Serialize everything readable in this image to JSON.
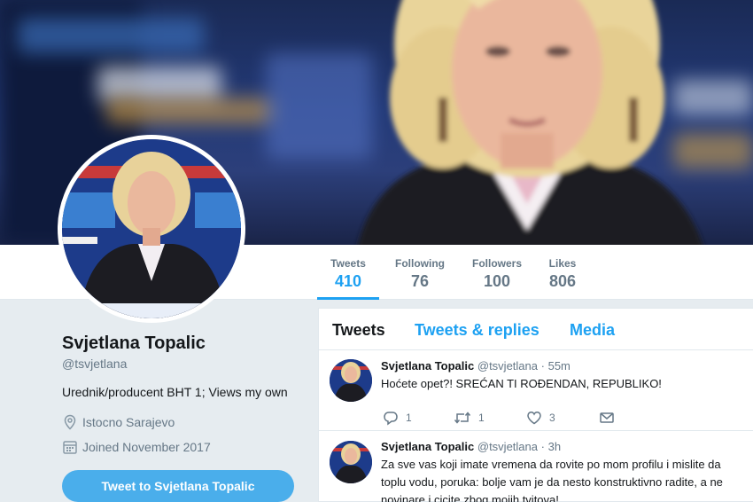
{
  "stats": [
    {
      "label": "Tweets",
      "value": "410"
    },
    {
      "label": "Following",
      "value": "76"
    },
    {
      "label": "Followers",
      "value": "100"
    },
    {
      "label": "Likes",
      "value": "806"
    }
  ],
  "profile": {
    "name": "Svjetlana Topalic",
    "handle": "@tsvjetlana",
    "bio": "Urednik/producent BHT 1; Views my own",
    "location": "Istocno Sarajevo",
    "joined": "Joined November 2017",
    "tweet_to_label": "Tweet to Svjetlana Topalic"
  },
  "tabs": [
    {
      "label": "Tweets"
    },
    {
      "label": "Tweets & replies"
    },
    {
      "label": "Media"
    }
  ],
  "tweets": [
    {
      "name": "Svjetlana Topalic",
      "handle": "@tsvjetlana",
      "dot": "·",
      "time": "55m",
      "lines": [
        "Hoćete opet?! SREĆAN TI ROĐENDAN, REPUBLIKO!"
      ],
      "replies": "1",
      "retweets": "1",
      "likes": "3"
    },
    {
      "name": "Svjetlana Topalic",
      "handle": "@tsvjetlana",
      "dot": "·",
      "time": "3h",
      "lines": [
        "Za sve vas koji imate vremena da rovite po mom profilu i mislite da",
        "toplu vodu, poruka: bolje vam je da nesto konstruktivno radite, a ne",
        "novinare i cicite zbog mojih tvitova!"
      ]
    }
  ],
  "colors": {
    "accent": "#1da1f2",
    "button": "#4aaeeb",
    "background": "#e6ecf0",
    "muted": "#657786"
  },
  "icons": {
    "location": "location-pin-icon",
    "calendar": "calendar-icon",
    "reply": "reply-icon",
    "retweet": "retweet-icon",
    "like": "heart-icon",
    "message": "envelope-icon"
  }
}
